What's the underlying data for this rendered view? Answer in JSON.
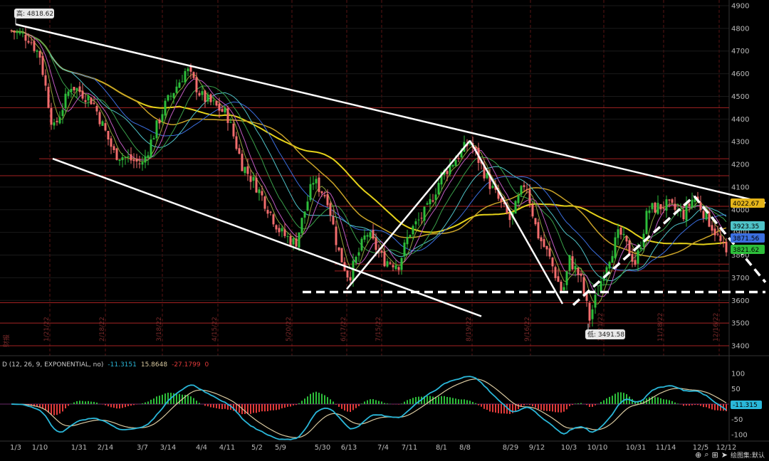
{
  "chart_data": {
    "type": "candlestick",
    "colors": {
      "bg": "#000000",
      "up": "#2dbd3a",
      "down": "#f26d6d",
      "ma_yellow": "#e5d21a",
      "ma_orange": "#c9a227",
      "ma_blue": "#3b6fe0",
      "ma_cyan": "#4fc3c8",
      "ma_green": "#3aa14a",
      "ma_magenta": "#c25bc2",
      "ma_olive": "#8fa33a",
      "trendline": "#ffffff",
      "hline": "#a32222",
      "macd_line": "#2ab7d9",
      "signal_line": "#d9c9a0",
      "hist_up": "#2dbd3a",
      "hist_down": "#e23a3a"
    },
    "y_ticks": [
      4900,
      4800,
      4700,
      4600,
      4500,
      4400,
      4300,
      4200,
      4100,
      4000,
      3900,
      3800,
      3700,
      3600,
      3500,
      3400
    ],
    "x_ticks": [
      "1/3",
      "1/10",
      "1/31",
      "2/14",
      "3/7",
      "3/14",
      "4/4",
      "4/11",
      "5/2",
      "5/9",
      "5/30",
      "6/13",
      "7/4",
      "7/11",
      "8/1",
      "8/8",
      "8/29",
      "9/12",
      "10/3",
      "10/10",
      "10/31",
      "11/14",
      "12/5",
      "12/12"
    ],
    "vertical_dates": [
      "1/21/22",
      "2/18/22",
      "3/18/22",
      "4/15/22",
      "5/20/22",
      "6/17/22",
      "7/15/22",
      "8/19/22",
      "9/16/22",
      "10/21/22",
      "11/18/22",
      "12/16/22"
    ],
    "left_vertical_label": "财报",
    "high_label": "高: 4818.62",
    "low_label": "低: 3491.58",
    "price_tags": [
      {
        "value": "4022.67",
        "color": "#e5b51a"
      },
      {
        "value": "3923.35",
        "color": "#4fc3c8"
      },
      {
        "value": "3871.56",
        "color": "#3b6fe0"
      },
      {
        "value": "3821.62",
        "color": "#2dbd3a"
      }
    ],
    "macd": {
      "label": "D (12, 26, 9, EXPONENTIAL, no)",
      "macd_value": "-11.3151",
      "signal_value": "15.8648",
      "hist_value": "-27.1799",
      "zero": "0",
      "y_ticks": [
        "100",
        "50",
        "-50",
        "-100"
      ],
      "current_tag": "-11.315"
    },
    "horizontal_levels": [
      4450,
      4225,
      4150,
      4015,
      3760,
      3730,
      3590,
      3500,
      3400
    ],
    "trendlines": [
      {
        "from": [
          "1/3",
          4818
        ],
        "to": [
          "12/22",
          4030
        ],
        "style": "solid"
      },
      {
        "from": [
          "1/21",
          4225
        ],
        "to": [
          "8/8",
          3530
        ],
        "style": "solid"
      },
      {
        "from": [
          "6/16",
          3650
        ],
        "to": [
          "8/16",
          4305
        ],
        "style": "solid"
      },
      {
        "from": [
          "8/16",
          4305
        ],
        "to": [
          "9/30",
          3585
        ],
        "style": "solid"
      },
      {
        "from": [
          "5/20",
          3637
        ],
        "to": [
          "12/22",
          3637
        ],
        "style": "dashed"
      },
      {
        "from": [
          "10/13",
          3580
        ],
        "to": [
          "12/1",
          4060
        ],
        "style": "dashed"
      },
      {
        "from": [
          "12/1",
          4060
        ],
        "to": [
          "12/22",
          3680
        ],
        "style": "dashed"
      }
    ]
  },
  "footer": {
    "label": "绘图集:默认"
  }
}
